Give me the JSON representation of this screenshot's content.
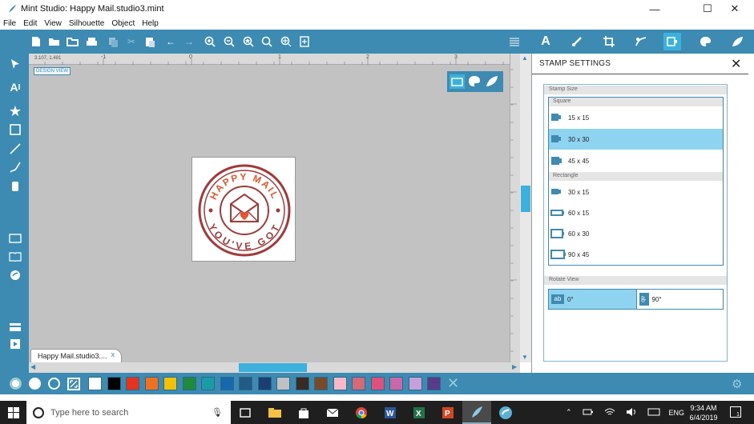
{
  "window": {
    "title": "Mint Studio: Happy Mail.studio3.mint",
    "minimize": "—",
    "maximize": "☐",
    "close": "✕"
  },
  "menu": [
    "File",
    "Edit",
    "View",
    "Silhouette",
    "Object",
    "Help"
  ],
  "canvas": {
    "design_view_label": "DESIGN VIEW",
    "coords": "3.107, 1.481",
    "ruler_labels": [
      "-1",
      "0",
      "1",
      "2",
      "3"
    ]
  },
  "stamp": {
    "top_text": "HAPPY MAIL",
    "bottom_text": "YOU'VE GOT",
    "color": "#c0392b",
    "accent": "#e8552f"
  },
  "document_tab": {
    "label": "Happy Mail.studio3....",
    "close": "x"
  },
  "panel": {
    "title": "STAMP SETTINGS",
    "close": "✕",
    "stamp_size_label": "Stamp Size",
    "square_label": "Square",
    "square_options": [
      "15 x 15",
      "30 x 30",
      "45 x 45"
    ],
    "square_selected": "30 x 30",
    "rectangle_label": "Rectangle",
    "rectangle_options": [
      "30 x 15",
      "60 x 15",
      "60 x 30",
      "90 x 45"
    ],
    "rotate_label": "Rotate View",
    "rotate_options": [
      "0°",
      "90°"
    ],
    "rotate_icons": [
      "ab",
      "ab"
    ],
    "rotate_selected": "0°"
  },
  "colors": {
    "toolbar": "#3d8bb3",
    "selection": "#8ed4f0",
    "swatches": [
      "#ffffff",
      "#000000",
      "#e8321e",
      "#f07020",
      "#f5c000",
      "#1f8a3c",
      "#1a9ba6",
      "#1868b0",
      "#235a86",
      "#1b3f72",
      "#c0c0c0",
      "#3a2a22",
      "#7a4a28",
      "#f8b8c8",
      "#d46a78",
      "#e0507a",
      "#c868a8",
      "#c8a0d8",
      "#5a3a8a"
    ]
  },
  "taskbar": {
    "search_placeholder": "Type here to search",
    "lang": "ENG",
    "time": "9:34 AM",
    "date": "6/4/2019",
    "notification_count": "1"
  }
}
